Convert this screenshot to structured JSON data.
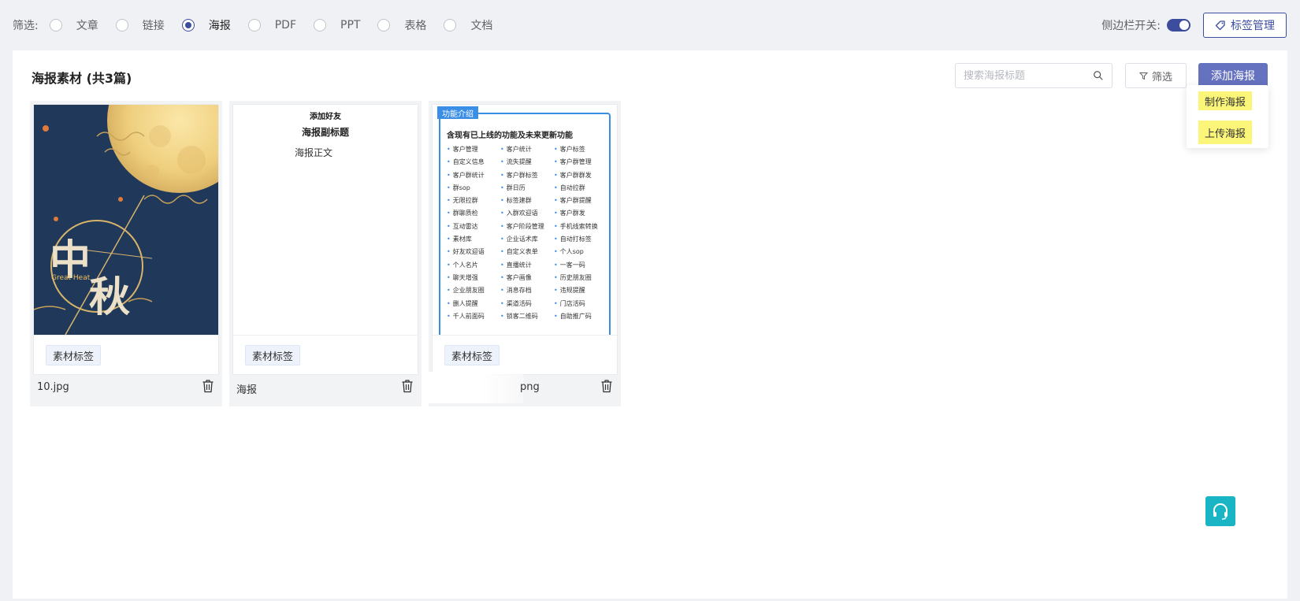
{
  "filter": {
    "label": "筛选:",
    "options": [
      {
        "label": "文章",
        "checked": false
      },
      {
        "label": "链接",
        "checked": false
      },
      {
        "label": "海报",
        "checked": true
      },
      {
        "label": "PDF",
        "checked": false
      },
      {
        "label": "PPT",
        "checked": false
      },
      {
        "label": "表格",
        "checked": false
      },
      {
        "label": "文档",
        "checked": false
      }
    ]
  },
  "header": {
    "sidebar_switch_label": "侧边栏开关:",
    "sidebar_switch_on": true,
    "tag_manage_label": "标签管理"
  },
  "panel": {
    "title": "海报素材 (共3篇)",
    "search_placeholder": "搜索海报标题",
    "filter_button": "筛选",
    "add_button": "添加海报",
    "dropdown": [
      "制作海报",
      "上传海报"
    ]
  },
  "cards": [
    {
      "name": "10.jpg",
      "tag": "素材标签",
      "poster_text": "Great Heat"
    },
    {
      "name": "海报",
      "tag": "素材标签",
      "poster_title": "添加好友",
      "poster_subtitle": "海报副标题",
      "poster_body": "海报正文"
    },
    {
      "name": "png",
      "tag": "素材标签",
      "badge": "功能介绍",
      "heading": "含现有已上线的功能及未来更新功能",
      "features": [
        "客户管理",
        "客户统计",
        "客户标签",
        "自定义信息",
        "流失提醒",
        "客户群管理",
        "客户群统计",
        "客户群标签",
        "客户群群发",
        "群sop",
        "群日历",
        "自动拉群",
        "无限拉群",
        "标签建群",
        "客户群提醒",
        "群聊质检",
        "入群欢迎语",
        "客户群发",
        "互动雷达",
        "客户阶段管理",
        "手机线索转换",
        "素材库",
        "企业话术库",
        "自动打标签",
        "好友欢迎语",
        "自定义表单",
        "个人sop",
        "个人名片",
        "直播统计",
        "一客一码",
        "聊天增强",
        "客户画像",
        "历史朋友圈",
        "企业朋友圈",
        "消息存档",
        "违规提醒",
        "删人提醒",
        "渠道活码",
        "门店活码",
        "千人前面码",
        "锁客二维码",
        "自助推广码"
      ]
    }
  ],
  "colors": {
    "accent": "#3d4d9e",
    "primary_button": "#6572c0",
    "highlight": "#fbf57a",
    "fab": "#19b5c4"
  }
}
